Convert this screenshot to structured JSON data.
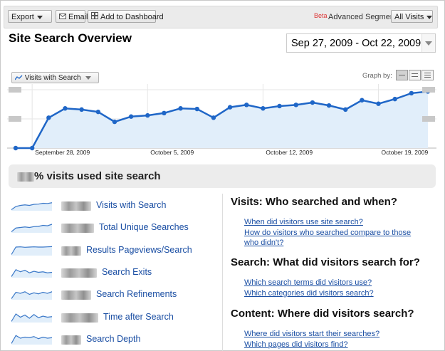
{
  "toolbar": {
    "export_label": "Export",
    "email_label": "Email",
    "dashboard_label": "Add to Dashboard",
    "beta_label": "Beta",
    "segments_label": "Advanced Segments:",
    "segments_value": "All Visits"
  },
  "page": {
    "title": "Site Search Overview",
    "date_range": "Sep 27, 2009 - Oct 22, 2009"
  },
  "graph": {
    "metric_label": "Visits with Search",
    "graph_by_label": "Graph by:"
  },
  "chart_data": {
    "type": "area",
    "series": [
      {
        "name": "Visits with Search",
        "values": [
          0.0,
          0.0,
          0.52,
          0.68,
          0.66,
          0.62,
          0.45,
          0.54,
          0.56,
          0.6,
          0.68,
          0.67,
          0.52,
          0.7,
          0.74,
          0.68,
          0.72,
          0.74,
          0.78,
          0.73,
          0.66,
          0.82,
          0.76,
          0.84,
          0.94,
          0.97
        ]
      }
    ],
    "x_ticks": [
      "September 28, 2009",
      "October 5, 2009",
      "October 12, 2009",
      "October 19, 2009"
    ],
    "x_tick_index": [
      1,
      8,
      15,
      22
    ],
    "y_range": [
      0,
      1
    ],
    "grid": true,
    "line_color": "#1f66c7",
    "fill_color": "#e1eefa"
  },
  "summary": {
    "text": "% visits used site search"
  },
  "metrics": [
    {
      "label": "Visits with Search",
      "spark": [
        0.1,
        0.4,
        0.5,
        0.55,
        0.5,
        0.6,
        0.62,
        0.7,
        0.68,
        0.75
      ]
    },
    {
      "label": "Total Unique Searches",
      "spark": [
        0.1,
        0.45,
        0.5,
        0.55,
        0.5,
        0.58,
        0.6,
        0.7,
        0.66,
        0.8
      ]
    },
    {
      "label": "Results Pageviews/Search",
      "spark": [
        0.1,
        0.8,
        0.82,
        0.78,
        0.8,
        0.82,
        0.8,
        0.8,
        0.82,
        0.84
      ]
    },
    {
      "label": "Search Exits",
      "spark": [
        0.1,
        0.75,
        0.55,
        0.7,
        0.45,
        0.6,
        0.5,
        0.55,
        0.45,
        0.5
      ]
    },
    {
      "label": "Search Refinements",
      "spark": [
        0.1,
        0.7,
        0.6,
        0.75,
        0.5,
        0.65,
        0.55,
        0.7,
        0.6,
        0.75
      ]
    },
    {
      "label": "Time after Search",
      "spark": [
        0.1,
        0.8,
        0.5,
        0.7,
        0.4,
        0.75,
        0.45,
        0.6,
        0.5,
        0.55
      ]
    },
    {
      "label": "Search Depth",
      "spark": [
        0.1,
        0.85,
        0.6,
        0.7,
        0.65,
        0.75,
        0.55,
        0.7,
        0.6,
        0.65
      ]
    }
  ],
  "sections": [
    {
      "title": "Visits: Who searched and when?",
      "links": [
        "When did visitors use site search?",
        "How do visitors who searched compare to those",
        "who didn't?"
      ]
    },
    {
      "title": "Search: What did visitors search for?",
      "links": [
        "Which search terms did visitors use?",
        "Which categories did visitors search?"
      ]
    },
    {
      "title": "Content: Where did visitors search?",
      "links": [
        "Where did visitors start their searches?",
        "Which pages did visitors find?"
      ]
    }
  ]
}
